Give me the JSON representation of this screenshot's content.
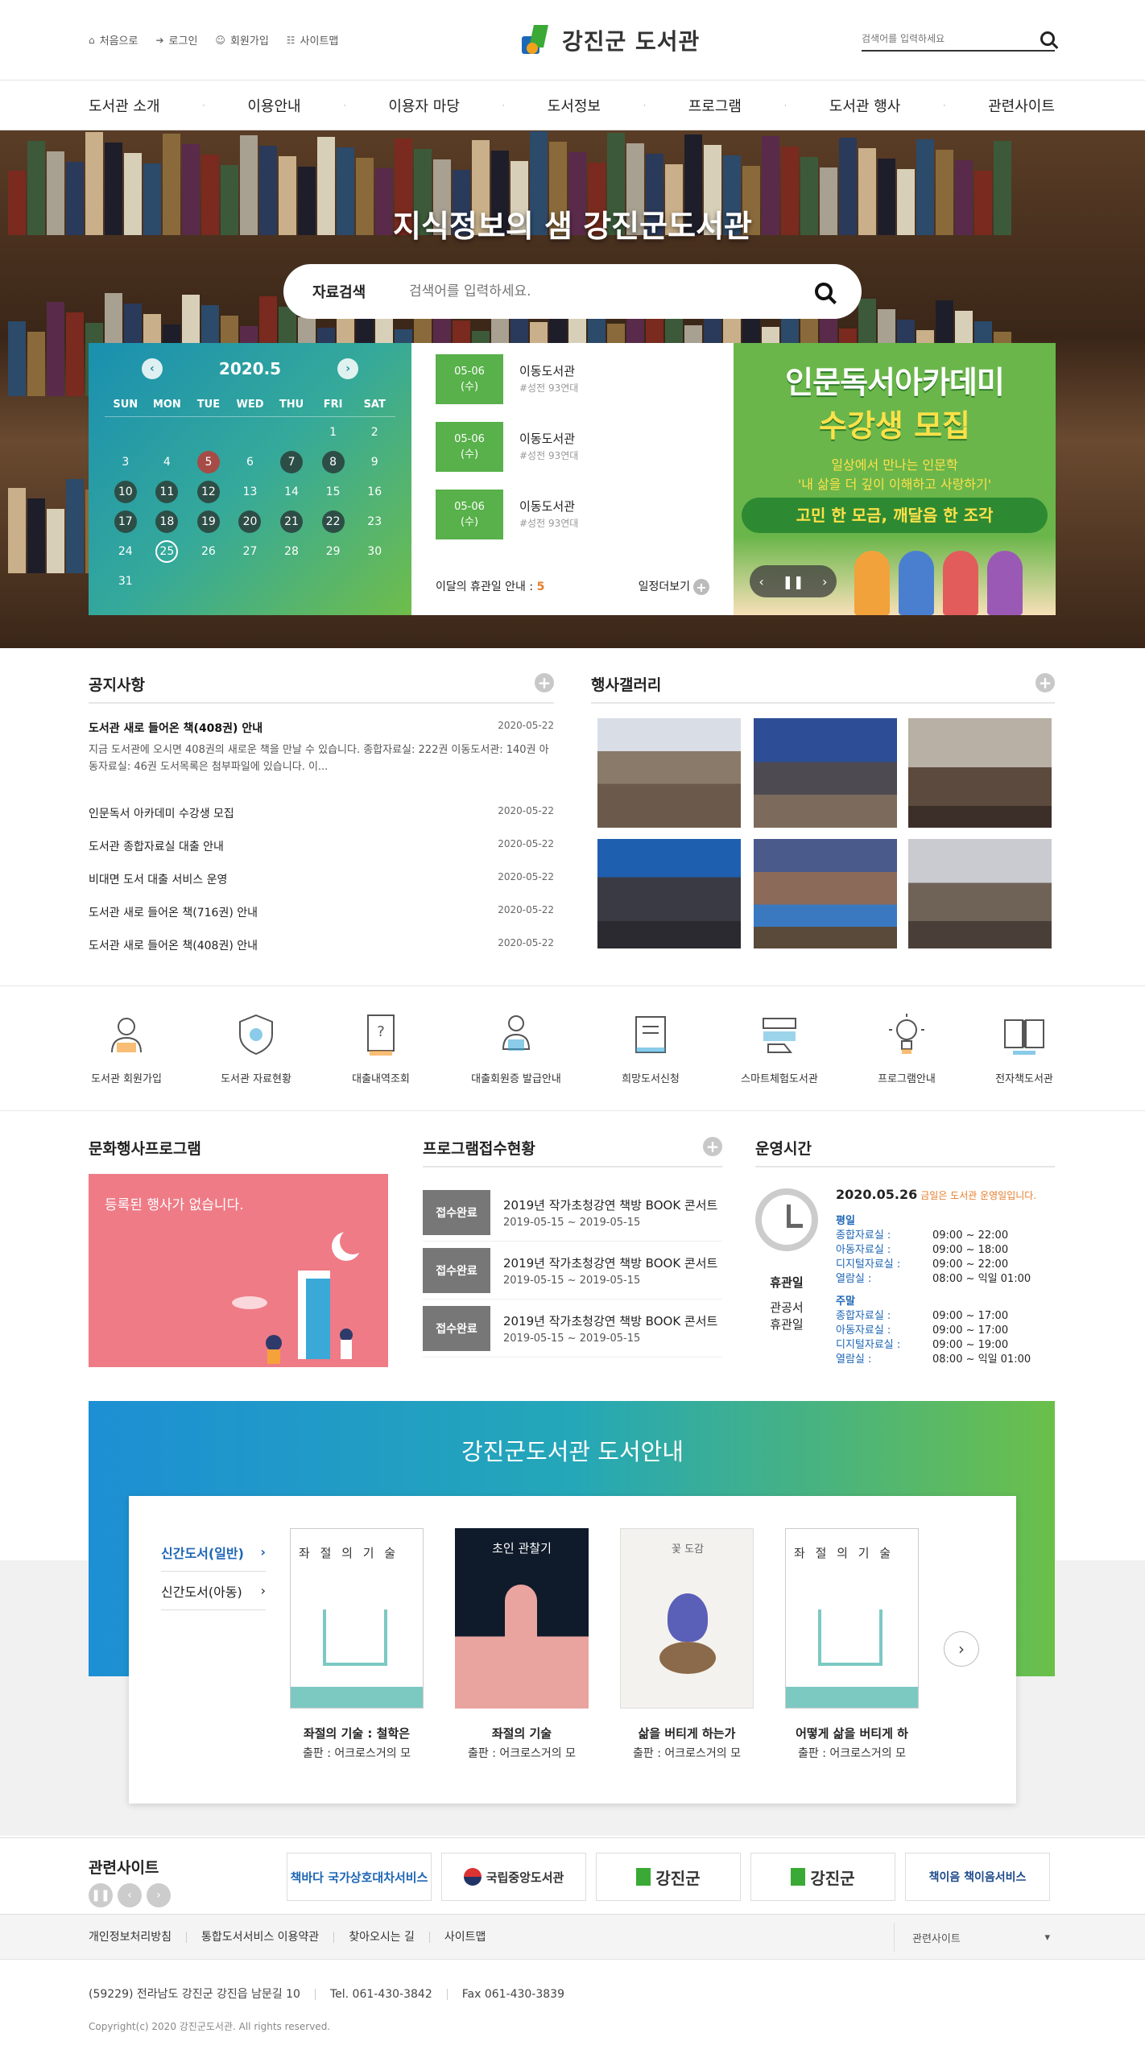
{
  "top": {
    "links": [
      {
        "icon": "home-icon",
        "glyph": "⌂",
        "label": "처음으로"
      },
      {
        "icon": "login-icon",
        "glyph": "➔",
        "label": "로그인"
      },
      {
        "icon": "user-icon",
        "glyph": "☺",
        "label": "회원가입"
      },
      {
        "icon": "sitemap-icon",
        "glyph": "☷",
        "label": "사이트맵"
      }
    ],
    "logo": "강진군 도서관",
    "search_placeholder": "검색어를 입력하세요"
  },
  "gnb": [
    "도서관 소개",
    "이용안내",
    "이용자 마당",
    "도서정보",
    "프로그램",
    "도서관 행사",
    "관련사이트"
  ],
  "hero": {
    "title": "지식정보의 샘 강진군도서관",
    "search_label": "자료검색",
    "search_placeholder": "검색어를 입력하세요."
  },
  "calendar": {
    "month": "2020.5",
    "days": [
      "SUN",
      "MON",
      "TUE",
      "WED",
      "THU",
      "FRI",
      "SAT"
    ],
    "weeks": [
      [
        "",
        "",
        "",
        "",
        "",
        "1",
        "2"
      ],
      [
        "3",
        "4",
        "5",
        "6",
        "7",
        "8",
        "9"
      ],
      [
        "10",
        "11",
        "12",
        "13",
        "14",
        "15",
        "16"
      ],
      [
        "17",
        "18",
        "19",
        "20",
        "21",
        "22",
        "23"
      ],
      [
        "24",
        "25",
        "26",
        "27",
        "28",
        "29",
        "30"
      ],
      [
        "31",
        "",
        "",
        "",
        "",
        "",
        ""
      ]
    ],
    "highlighted": [
      "7",
      "8",
      "10",
      "11",
      "12",
      "17",
      "18",
      "19",
      "20",
      "21",
      "22"
    ],
    "red": [
      "5"
    ],
    "today": "25"
  },
  "schedule": {
    "items": [
      {
        "date": "05-06",
        "day": "(수)",
        "title": "이동도서관",
        "sub": "#성전 93연대"
      },
      {
        "date": "05-06",
        "day": "(수)",
        "title": "이동도서관",
        "sub": "#성전 93연대"
      },
      {
        "date": "05-06",
        "day": "(수)",
        "title": "이동도서관",
        "sub": "#성전 93연대"
      }
    ],
    "closed_label": "이달의 휴관일 안내 :",
    "closed_count": "5",
    "more": "일정더보기"
  },
  "banner": {
    "line1": "인문독서아카데미",
    "line2": "수강생 모집",
    "line3": "일상에서 만나는 인문학",
    "line4": "'내 삶을 더 깊이 이해하고 사랑하기'",
    "line5": "고민 한 모금, 깨달음 한 조각"
  },
  "notice": {
    "title": "공지사항",
    "first": {
      "title": "도서관 새로 들어온 책(408권) 안내",
      "date": "2020-05-22",
      "desc": "지금 도서관에 오시면 408권의 새로운 책을 만날 수 있습니다. 종합자료실: 222권 이동도서관: 140권 아동자료실: 46권 도서목록은 첨부파일에 있습니다. 이..."
    },
    "items": [
      {
        "title": "인문독서 아카데미 수강생 모집",
        "date": "2020-05-22"
      },
      {
        "title": "도서관 종합자료실 대출 안내",
        "date": "2020-05-22"
      },
      {
        "title": "비대면 도서 대출 서비스 운영",
        "date": "2020-05-22"
      },
      {
        "title": "도서관 새로 들어온 책(716권) 안내",
        "date": "2020-05-22"
      },
      {
        "title": "도서관 새로 들어온 책(408권) 안내",
        "date": "2020-05-22"
      }
    ]
  },
  "gallery": {
    "title": "행사갤러리"
  },
  "quick": [
    {
      "icon": "member-icon",
      "label": "도서관 회원가입"
    },
    {
      "icon": "shield-icon",
      "label": "도서관 자료현황"
    },
    {
      "icon": "loan-history-icon",
      "label": "대출내역조회"
    },
    {
      "icon": "card-issue-icon",
      "label": "대출회원증 발급안내"
    },
    {
      "icon": "book-request-icon",
      "label": "희망도서신청"
    },
    {
      "icon": "smart-library-icon",
      "label": "스마트체험도서관"
    },
    {
      "icon": "program-icon",
      "label": "프로그램안내"
    },
    {
      "icon": "ebook-icon",
      "label": "전자책도서관"
    }
  ],
  "culture": {
    "title": "문화행사프로그램",
    "empty": "등록된 행사가 없습니다."
  },
  "program": {
    "title": "프로그램접수현황",
    "items": [
      {
        "badge": "접수완료",
        "title": "2019년 작가초청강연 책방 BOOK 콘서트",
        "date": "2019-05-15 ~ 2019-05-15"
      },
      {
        "badge": "접수완료",
        "title": "2019년 작가초청강연 책방 BOOK 콘서트",
        "date": "2019-05-15 ~ 2019-05-15"
      },
      {
        "badge": "접수완료",
        "title": "2019년 작가초청강연 책방 BOOK 콘서트",
        "date": "2019-05-15 ~ 2019-05-15"
      }
    ]
  },
  "hours": {
    "title": "운영시간",
    "date": "2020.05.26",
    "date_note": "금일은 도서관 운영일입니다.",
    "closed_label": "휴관일",
    "closed_sub": "관공서\n휴관일",
    "weekday_title": "평일",
    "weekday": [
      {
        "k": "종합자료실 :",
        "v": "09:00 ~ 22:00"
      },
      {
        "k": "아동자료실 :",
        "v": "09:00 ~ 18:00"
      },
      {
        "k": "디지털자료실 :",
        "v": "09:00 ~ 22:00"
      },
      {
        "k": "열람실 :",
        "v": "08:00 ~ 익일 01:00"
      }
    ],
    "weekend_title": "주말",
    "weekend": [
      {
        "k": "종합자료실 :",
        "v": "09:00 ~ 17:00"
      },
      {
        "k": "아동자료실 :",
        "v": "09:00 ~ 17:00"
      },
      {
        "k": "디지털자료실 :",
        "v": "09:00 ~ 19:00"
      },
      {
        "k": "열람실 :",
        "v": "08:00 ~ 익일 01:00"
      }
    ]
  },
  "books": {
    "title": "강진군도서관 도서안내",
    "tabs": [
      "신간도서(일반)",
      "신간도서(아동)"
    ],
    "items": [
      {
        "name": "좌절의 기술 : 철학은",
        "pub": "출판 : 어크로스거의 모",
        "cover": "좌 절 의 기 술"
      },
      {
        "name": "좌절의 기술",
        "pub": "출판 : 어크로스거의 모",
        "cover": "초인 관찰기"
      },
      {
        "name": "삶을 버티게 하는가",
        "pub": "출판 : 어크로스거의 모",
        "cover": "꽃 도감"
      },
      {
        "name": "어떻게 삶을 버티게 하",
        "pub": "출판 : 어크로스거의 모",
        "cover": "좌 절 의 기 술"
      }
    ]
  },
  "related": {
    "title": "관련사이트",
    "sites": [
      "책바다 국가상호대차서비스",
      "국립중앙도서관",
      "강진군",
      "강진군",
      "책이음 책이음서비스"
    ]
  },
  "footer": {
    "links": [
      "개인정보처리방침",
      "통합도서서비스 이용약관",
      "찾아오시는 길",
      "사이트맵"
    ],
    "select": "관련사이트",
    "addr": "(59229) 전라남도 강진군 강진읍 남문길 10",
    "tel": "Tel. 061-430-3842",
    "fax": "Fax 061-430-3839",
    "copy": "Copyright(c) 2020 강진군도서관. All rights reserved."
  }
}
